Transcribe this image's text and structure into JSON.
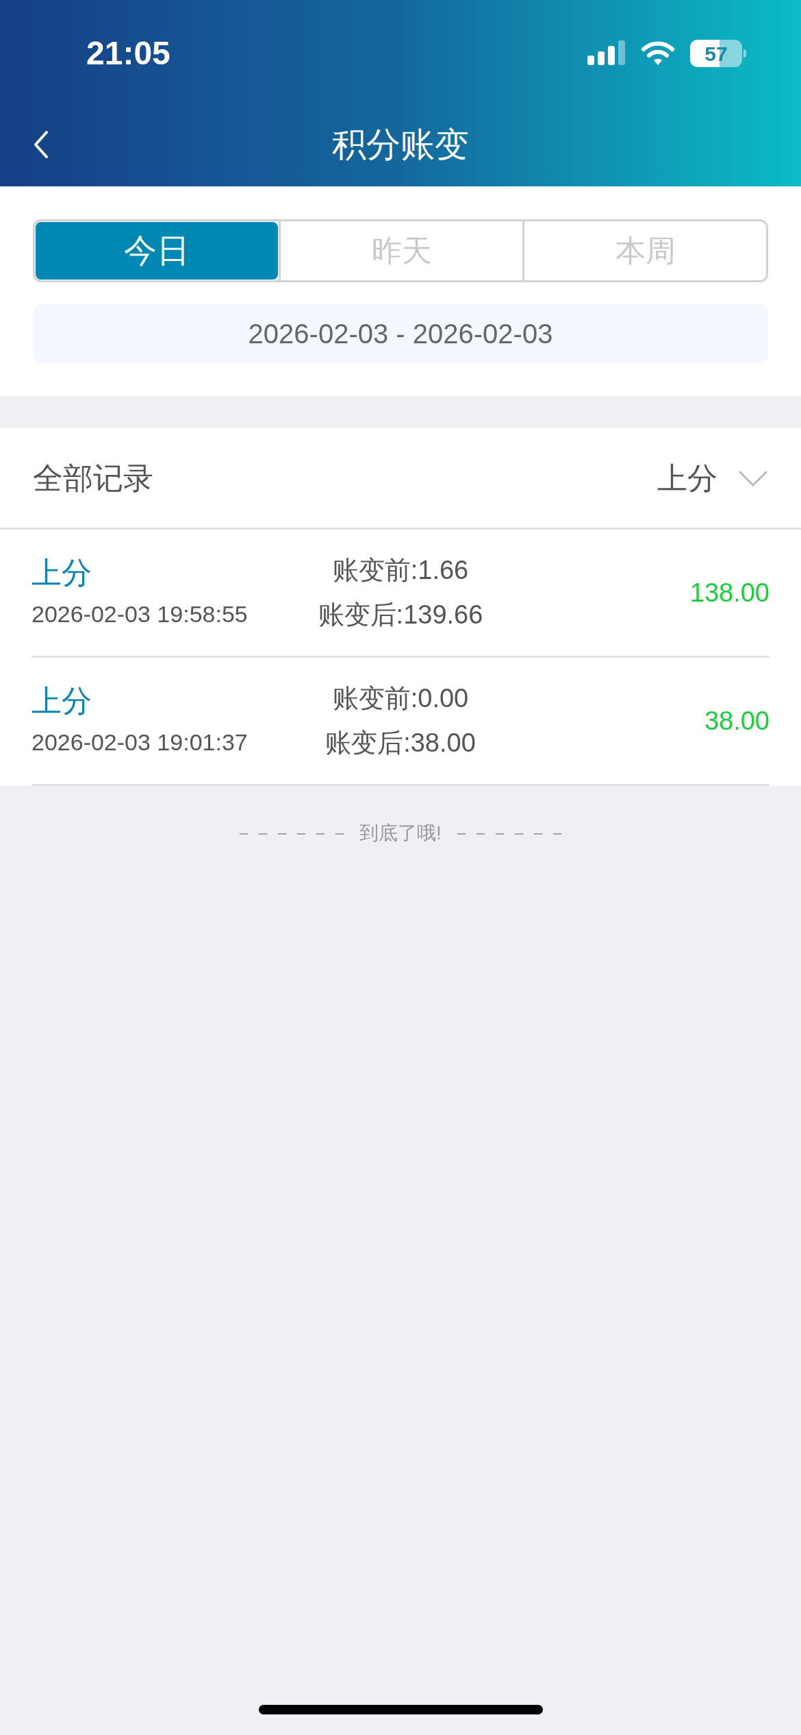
{
  "status_bar": {
    "time": "21:05",
    "battery": "57"
  },
  "nav": {
    "title": "积分账变"
  },
  "tabs": [
    {
      "label": "今日",
      "selected": true
    },
    {
      "label": "昨天",
      "selected": false
    },
    {
      "label": "本周",
      "selected": false
    }
  ],
  "date_range": "2026-02-03 - 2026-02-03",
  "filter": {
    "label": "全部记录",
    "value": "上分"
  },
  "records": [
    {
      "type": "上分",
      "time": "2026-02-03 19:58:55",
      "before": "账变前:1.66",
      "after": "账变后:139.66",
      "amount": "138.00"
    },
    {
      "type": "上分",
      "time": "2026-02-03 19:01:37",
      "before": "账变前:0.00",
      "after": "账变后:38.00",
      "amount": "38.00"
    }
  ],
  "end_note": "－－－－－－  到底了哦!  －－－－－－"
}
